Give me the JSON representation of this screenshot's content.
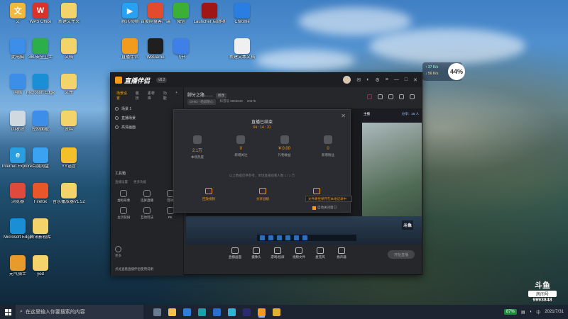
{
  "desktop": {
    "icons": [
      {
        "label": "文",
        "color": "#f2b93b",
        "glyph": "文"
      },
      {
        "label": "WPS Office",
        "color": "#d9332a",
        "glyph": "W"
      },
      {
        "label": "新建文件夹",
        "color": "#f2d46b",
        "glyph": ""
      },
      {
        "label": "腾讯视频",
        "color": "#29a1f3",
        "glyph": "▶"
      },
      {
        "label": "百度网盘客户端",
        "color": "#e24b2b",
        "glyph": ""
      },
      {
        "label": "微信",
        "color": "#3cb034",
        "glyph": ""
      },
      {
        "label": "Launcher 启动项",
        "color": "#a01515",
        "glyph": ""
      },
      {
        "label": "Chrome",
        "color": "#2a7de1",
        "glyph": ""
      },
      {
        "label": "此电脑",
        "color": "#3d8ee8",
        "glyph": ""
      },
      {
        "label": "360安全卫士",
        "color": "#2cae4a",
        "glyph": ""
      },
      {
        "label": "文档",
        "color": "#f2d46b",
        "glyph": ""
      },
      {
        "label": "直播伴侣",
        "color": "#f39b1c",
        "glyph": ""
      },
      {
        "label": "WeGame",
        "color": "#1f1f1f",
        "glyph": ""
      },
      {
        "label": "飞书",
        "color": "#3f7fe8",
        "glyph": ""
      },
      {
        "label": "新建文本文档",
        "color": "#f0f0f0",
        "glyph": ""
      },
      {
        "label": "网络",
        "color": "#3d8ee8",
        "glyph": ""
      },
      {
        "label": "Microsoft Edge",
        "color": "#1b8fd6",
        "glyph": ""
      },
      {
        "label": "文件",
        "color": "#f2d46b",
        "glyph": ""
      },
      {
        "label": "回收站",
        "color": "#d0d8e0",
        "glyph": ""
      },
      {
        "label": "控制面板",
        "color": "#3d8ee8",
        "glyph": ""
      },
      {
        "label": "资料",
        "color": "#f2d46b",
        "glyph": ""
      },
      {
        "label": "Internet Explorer",
        "color": "#2a9fe0",
        "glyph": "e"
      },
      {
        "label": "百度网盘",
        "color": "#3aa2f0",
        "glyph": ""
      },
      {
        "label": "YY语音",
        "color": "#f3c02a",
        "glyph": ""
      },
      {
        "label": "Firefox",
        "color": "#e8572a",
        "glyph": ""
      },
      {
        "label": "浏览器",
        "color": "#e04a3c",
        "glyph": ""
      },
      {
        "label": "音乐播放器V1.52 绿色",
        "color": "#f2d46b",
        "glyph": ""
      },
      {
        "label": "Microsoft Edge",
        "color": "#1b8fd6",
        "glyph": ""
      },
      {
        "label": "腾讯影视库",
        "color": "#f2d46b",
        "glyph": ""
      },
      {
        "label": "元气骑士",
        "color": "#e89a2a",
        "glyph": ""
      },
      {
        "label": "yod",
        "color": "#f2d46b",
        "glyph": ""
      }
    ]
  },
  "widget": {
    "line1": "↑ 37 K/s",
    "line2": "↓ 56 K/s",
    "percent": "44%"
  },
  "app": {
    "name": "直播伴侣",
    "version": "v8.2",
    "left_tabs": [
      "场景设置",
      "装扮",
      "素材库",
      "功能",
      "游戏",
      "更多"
    ],
    "scenes": [
      "场景 1",
      "直播场景",
      "高清画面"
    ],
    "toolbox_title": "工具箱",
    "toolbox_tabs": [
      "直播设置",
      "更多功能"
    ],
    "tools": [
      "虚拟形象",
      "连屏直播",
      "音效",
      "主页装扮",
      "互动玩法",
      "PK",
      "更多工具"
    ],
    "more_label": "更多",
    "notice": "点此查看直播伴侣使用说明",
    "room_title": "脚分之路……",
    "edit_label": "修改",
    "tags": [
      "OHIO · 哈兹耐心",
      "抖音号 9993848",
      "20675"
    ],
    "preview_left": "主播",
    "preview_right": "分享：16 人",
    "watermark_brand": "斗鱼",
    "controls": [
      "直播画面",
      "摄像头",
      "游戏/投屏",
      "视频文件",
      "麦克风",
      "扬声器"
    ],
    "go_live": "开始直播"
  },
  "dialog": {
    "title": "直播已结束",
    "time": "04 : 14 : 31",
    "stats": [
      {
        "value": "2.1万",
        "name": "本场热度"
      },
      {
        "value": "0",
        "name": "新增关注"
      },
      {
        "value": "¥ 0.00",
        "name": "礼物收益"
      },
      {
        "value": "0",
        "name": "新增粉丝"
      }
    ],
    "note": "以上数据仅供参考，本场直播观看人数 1 / 1 万",
    "actions": [
      "回放视频",
      "分享战绩",
      "直播日报"
    ],
    "tip": "文件路径保存在本地记录中",
    "auto_stop": "自动关闭窗口"
  },
  "watermark": {
    "brand": "斗鱼",
    "sub": "房间号",
    "room": "9993848"
  },
  "taskbar": {
    "search_placeholder": "在这里输入你要搜索的内容",
    "battery": "87%",
    "time": "",
    "date": "2021/7/31"
  }
}
